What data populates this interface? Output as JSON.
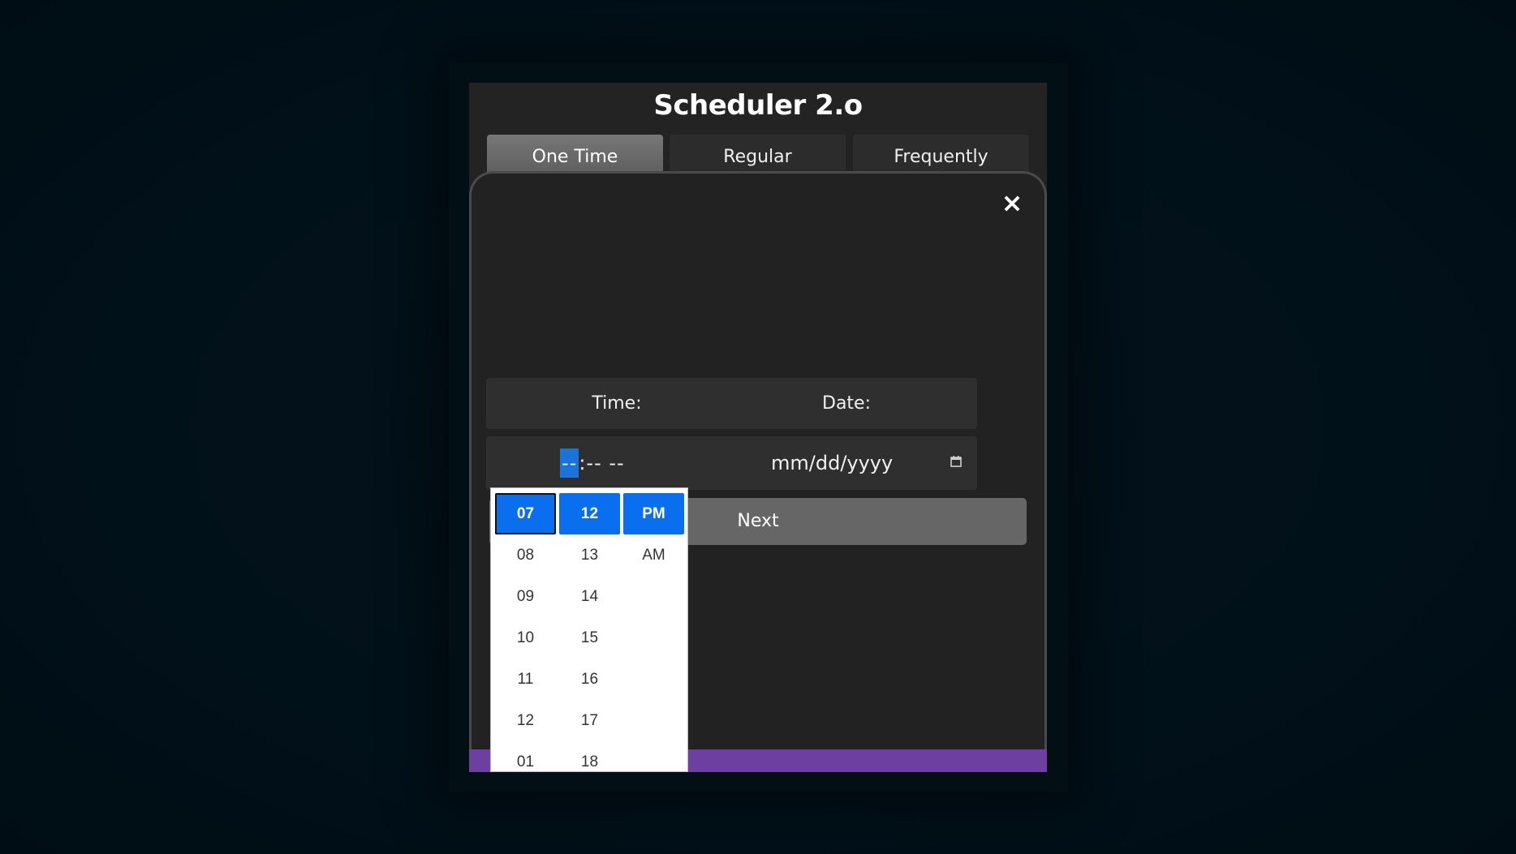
{
  "app": {
    "title": "Scheduler 2.o"
  },
  "tabs": [
    {
      "label": "One Time",
      "active": true
    },
    {
      "label": "Regular",
      "active": false
    },
    {
      "label": "Frequently",
      "active": false
    }
  ],
  "modal": {
    "close_icon": "×",
    "time_label": "Time:",
    "date_label": "Date:",
    "time_field": {
      "hour_segment": "--",
      "rest": ":-- --",
      "icon": "clock-icon"
    },
    "date_field": {
      "placeholder": "mm/dd/yyyy",
      "icon": "calendar-icon"
    },
    "next_label": "Next"
  },
  "time_picker": {
    "hours": [
      "07",
      "08",
      "09",
      "10",
      "11",
      "12",
      "01"
    ],
    "minutes": [
      "12",
      "13",
      "14",
      "15",
      "16",
      "17",
      "18"
    ],
    "ampm": [
      "PM",
      "AM"
    ],
    "selected": {
      "hour": "07",
      "minute": "12",
      "ampm": "PM"
    }
  },
  "colors": {
    "accent": "#0a6fee",
    "footer_bar": "#6c3fa0",
    "background": "#01111a"
  }
}
